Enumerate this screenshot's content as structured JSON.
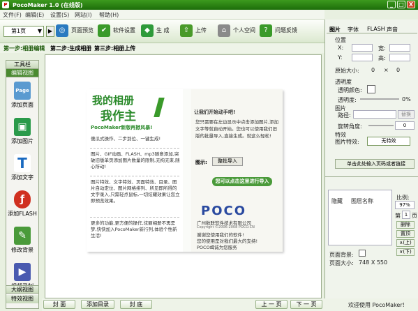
{
  "window": {
    "title": "PocoMaker 1.0 (在线版)",
    "min": "_",
    "max": "□",
    "close": "X"
  },
  "menu": [
    "文件(F)",
    "编辑(E)",
    "设置(S)",
    "网站(I)",
    "帮助(H)"
  ],
  "toolbar": {
    "page_select": "第1页",
    "preview": "页面预览",
    "settings": "软件设置",
    "generate": "生 成",
    "upload": "上传",
    "space": "个人空间",
    "faq": "问题反馈"
  },
  "steps": [
    "第一步:相册编辑",
    "第二步:生成相册",
    "第三步:相册上传"
  ],
  "sidebar": {
    "header1": "工具栏",
    "header2": "编辑视图",
    "items": [
      "添加页面",
      "添加图片",
      "添加文字",
      "添加FLASH",
      "修改背景",
      "视频录制"
    ],
    "header3": "大纲视图",
    "header4": "特效视图"
  },
  "album": {
    "title1": "我的相册",
    "title2": "我作主",
    "tagline": "PocoMaker新版再掀风暴!",
    "p1": "傻瓜式操作、二步到位、一键生成!",
    "p2": "图片、GIF动画、FLASH、mp3随意添加,突破旧版单页添加图片数量的限制,无拘无束,随心所动!",
    "p3": "图片特效、文字特效、页面特效、目录、图片自动定位、图片网格排列、所见即所得的文字录入,只需轻点鼠标,一切炫耀效果让您立即预览效果。",
    "p4": "更多的功能,更方便的操作,炫丽相册不再是梦,快快加入PocoMaker新行列,体验个性新生活!",
    "right_title": "让我们开始动手吧!",
    "right_text": "您只需要在左边显示中点击添加图片,添加文字等就自动开始。您也可以使用我们旧版的批量导入,直接生成。就这么轻松!",
    "import_label": "图示:",
    "import_btn": "整批导入",
    "import_hint": "您可以点击这里进行导入",
    "logo": "POCO",
    "company": "广州数联软件技术有限公司",
    "copyright": "Copyright ©2006-2008 POCO.CN",
    "thanks1": "谢谢您使用我们的软件!",
    "thanks2": "您的使用是对我们最大的支持!",
    "thanks3": "POCO竭诚为您服务"
  },
  "bottom": {
    "cover": "封 面",
    "add_toc": "添加目录",
    "back": "封 底",
    "prev": "上 一 页",
    "next": "下 一 页"
  },
  "panel": {
    "tabs": [
      "图片",
      "字体",
      "FLASH",
      "声音"
    ],
    "position": "位置",
    "x": "X:",
    "w": "宽:",
    "y": "Y:",
    "h": "高:",
    "orig": "原始大小:",
    "orig_val": "0",
    "times": "×",
    "orig_val2": "0",
    "transparency": "透明度",
    "trans_color": "透明颜色:",
    "trans_level": "透明度:",
    "trans_pct": "0%",
    "image": "图片",
    "path": "路径:",
    "replace": "替换",
    "rotate": "旋转角度:",
    "rotate_val": "0",
    "special": "特效",
    "img_special": "图片特效:",
    "special_val": "无特效",
    "link": "单击此处输入页码或者链接"
  },
  "layers": {
    "hide": "隐藏",
    "name": "图层名称",
    "ratio": "比例:",
    "ratio_val": "97%",
    "page_pre": "第",
    "page_num": "1",
    "page_suf": "页",
    "delete": "删除",
    "top": "置顶",
    "up": "∧(上)",
    "down": "∨(下)",
    "bg": "页面背景:",
    "size": "页面大小:",
    "size_val": "748 X 550"
  },
  "status": {
    "welcome": "欢迎使用 PocoMaker!"
  }
}
